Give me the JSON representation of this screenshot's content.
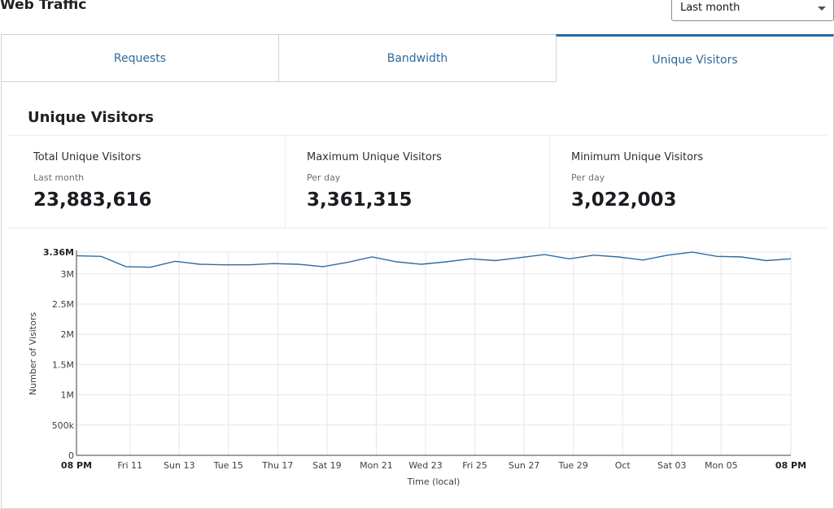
{
  "header": {
    "title": "Web Traffic"
  },
  "range_select": {
    "value": "Last month"
  },
  "tabs": [
    {
      "label": "Requests"
    },
    {
      "label": "Bandwidth"
    },
    {
      "label": "Unique Visitors"
    }
  ],
  "section": {
    "title": "Unique Visitors"
  },
  "stats": [
    {
      "label": "Total Unique Visitors",
      "sub": "Last month",
      "value": "23,883,616"
    },
    {
      "label": "Maximum Unique Visitors",
      "sub": "Per day",
      "value": "3,361,315"
    },
    {
      "label": "Minimum Unique Visitors",
      "sub": "Per day",
      "value": "3,022,003"
    }
  ],
  "colors": {
    "accent": "#2b6a9f",
    "line": "#2e6da4",
    "grid": "#e6e6e6"
  },
  "chart_data": {
    "type": "line",
    "xlabel": "Time (local)",
    "ylabel": "Number of Visitors",
    "ylim": [
      0,
      3361315
    ],
    "y_ticks": [
      {
        "label": "0",
        "value": 0
      },
      {
        "label": "500k",
        "value": 500000
      },
      {
        "label": "1M",
        "value": 1000000
      },
      {
        "label": "1.5M",
        "value": 1500000
      },
      {
        "label": "2M",
        "value": 2000000
      },
      {
        "label": "2.5M",
        "value": 2500000
      },
      {
        "label": "3M",
        "value": 3000000
      },
      {
        "label": "3.36M",
        "value": 3361315,
        "bold": true
      }
    ],
    "x_domain": [
      0,
      29
    ],
    "x_ticks": [
      {
        "label": "08 PM",
        "x": 0,
        "bold": true
      },
      {
        "label": "Fri 11",
        "x": 2.17
      },
      {
        "label": "Sun 13",
        "x": 4.17
      },
      {
        "label": "Tue 15",
        "x": 6.17
      },
      {
        "label": "Thu 17",
        "x": 8.17
      },
      {
        "label": "Sat 19",
        "x": 10.17
      },
      {
        "label": "Mon 21",
        "x": 12.17
      },
      {
        "label": "Wed 23",
        "x": 14.17
      },
      {
        "label": "Fri 25",
        "x": 16.17
      },
      {
        "label": "Sun 27",
        "x": 18.17
      },
      {
        "label": "Tue 29",
        "x": 20.17
      },
      {
        "label": "Oct",
        "x": 22.17
      },
      {
        "label": "Sat 03",
        "x": 24.17
      },
      {
        "label": "Mon 05",
        "x": 26.17
      },
      {
        "label": "08 PM",
        "x": 29,
        "bold": true
      }
    ],
    "x_grid": [
      2.17,
      4.17,
      6.17,
      8.17,
      10.17,
      12.17,
      14.17,
      16.17,
      18.17,
      20.17,
      22.17,
      24.17,
      26.17,
      29
    ],
    "series": [
      {
        "x": [
          0,
          1,
          2,
          3,
          4,
          5,
          6,
          7,
          8,
          9,
          10,
          11,
          12,
          13,
          14,
          15,
          16,
          17,
          18,
          19,
          20,
          21,
          22,
          23,
          24,
          25,
          26,
          27,
          28,
          29
        ],
        "values": [
          3300000,
          3290000,
          3120000,
          3110000,
          3210000,
          3160000,
          3150000,
          3150000,
          3170000,
          3160000,
          3120000,
          3190000,
          3280000,
          3200000,
          3160000,
          3200000,
          3250000,
          3220000,
          3270000,
          3320000,
          3250000,
          3310000,
          3280000,
          3230000,
          3310000,
          3360000,
          3290000,
          3280000,
          3220000,
          3250000
        ]
      }
    ]
  }
}
